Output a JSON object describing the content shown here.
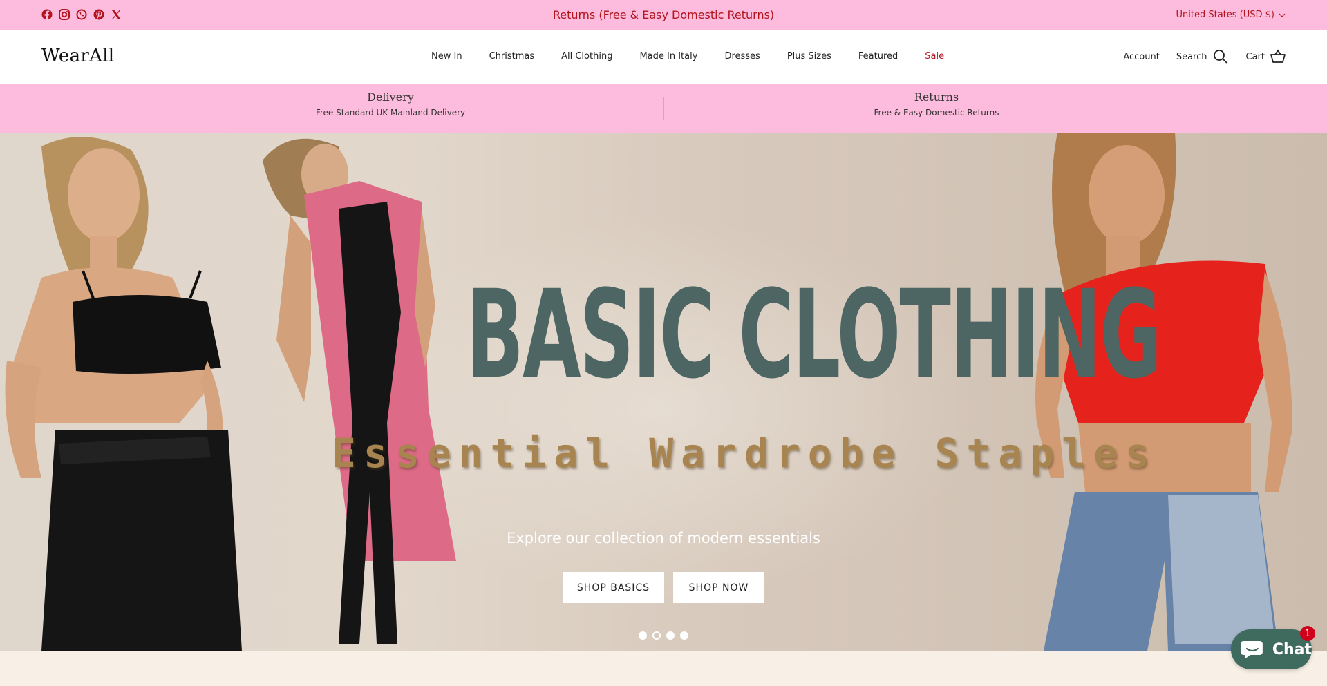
{
  "announcement": {
    "text": "Returns (Free & Easy Domestic Returns)",
    "social_icons": [
      "facebook-icon",
      "instagram-icon",
      "whatsapp-icon",
      "pinterest-icon",
      "x-icon"
    ],
    "currency": "United States (USD $)",
    "accent_color": "#b3141d",
    "bg_color": "#fdbcdd"
  },
  "header": {
    "logo": "WearAll",
    "nav": [
      "New In",
      "Christmas",
      "All Clothing",
      "Made In Italy",
      "Dresses",
      "Plus Sizes",
      "Featured",
      "Sale"
    ],
    "account_label": "Account",
    "search_label": "Search",
    "cart_label": "Cart"
  },
  "features": [
    {
      "title": "Delivery",
      "subtitle": "Free Standard UK Mainland Delivery"
    },
    {
      "title": "Returns",
      "subtitle": "Free & Easy Domestic Returns"
    }
  ],
  "hero": {
    "headline": "BASIC CLOTHING",
    "subheadline": "Essential Wardrobe Staples",
    "tagline": "Explore our collection of modern essentials",
    "buttons": [
      "SHOP BASICS",
      "SHOP NOW"
    ],
    "slides": 4,
    "active_slide": 2,
    "headline_color": "#4e6663",
    "subheadline_color": "#a88550"
  },
  "chat": {
    "label": "Chat",
    "badge": "1",
    "color": "#3f6a5e"
  }
}
